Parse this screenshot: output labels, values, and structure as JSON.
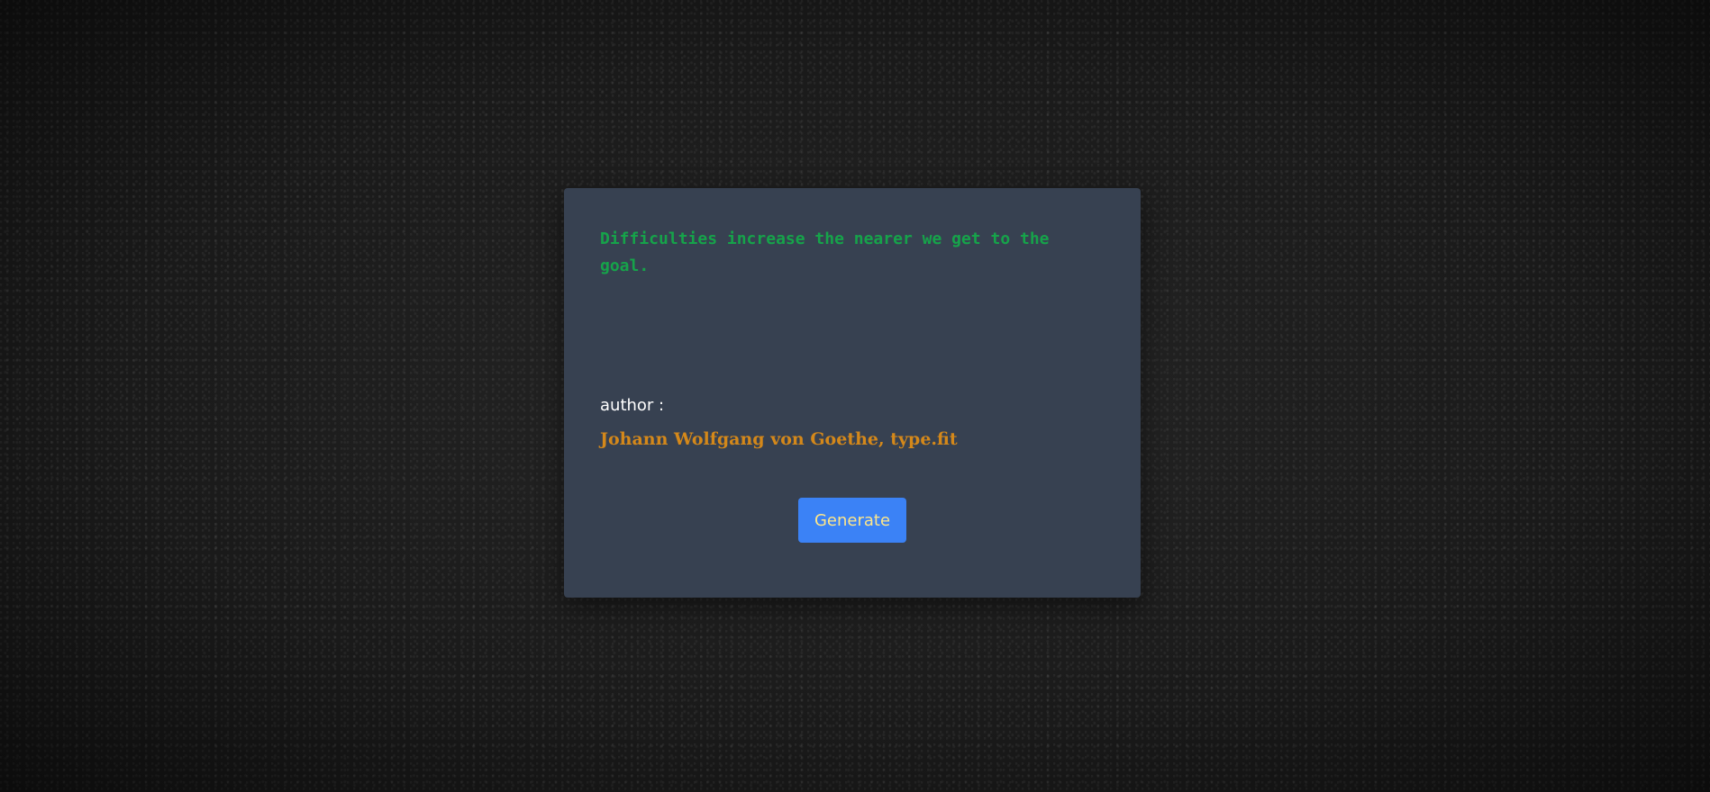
{
  "quote": {
    "text": "Difficulties increase the nearer we get to the goal."
  },
  "author": {
    "label": "author :",
    "name": "Johann Wolfgang von Goethe, type.fit"
  },
  "actions": {
    "generate_label": "Generate"
  },
  "colors": {
    "background": "#1a1a1a",
    "card": "#374151",
    "quote_text": "#16a34a",
    "author_label": "#ffffff",
    "author_name": "#d4881a",
    "button_bg": "#3b82f6",
    "button_text": "#fde68a"
  }
}
